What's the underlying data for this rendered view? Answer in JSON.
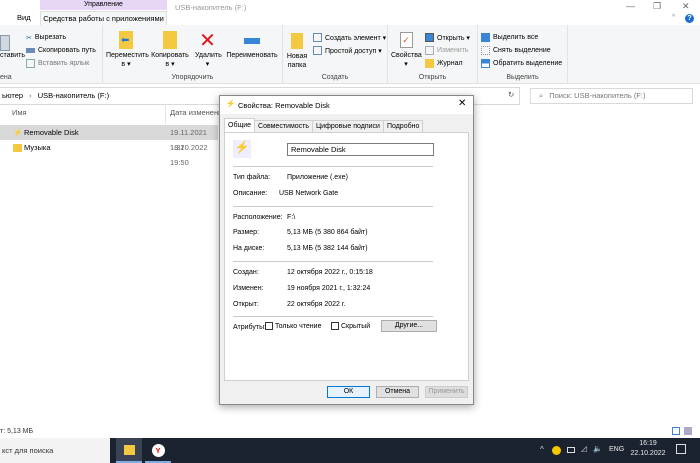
{
  "window": {
    "title": "USB-накопитель (F:)",
    "context_group": "Управление",
    "minimize": "—",
    "maximize": "❐",
    "close": "✕",
    "help": "?"
  },
  "tabs": {
    "view": "Вид",
    "app_tools": "Средства работы с приложениями"
  },
  "ribbon": {
    "clipboard": {
      "paste": "ставить",
      "cut": "Вырезать",
      "copy_path": "Скопировать путь",
      "paste_shortcut": "Вставить ярлык",
      "label": "ена"
    },
    "organize": {
      "move": "Переместить",
      "move2": "в ▾",
      "copy": "Копировать",
      "copy2": "в ▾",
      "delete": "Удалить",
      "delete2": "▾",
      "rename": "Переименовать",
      "label": "Упорядочить"
    },
    "create": {
      "new_folder": "Новая",
      "new_folder2": "папка",
      "new_item": "Создать элемент ▾",
      "easy_access": "Простой доступ ▾",
      "label": "Создать"
    },
    "open": {
      "properties": "Свойства",
      "properties2": "▾",
      "open": "Открыть ▾",
      "edit": "Изменить",
      "history": "Журнал",
      "label": "Открыть"
    },
    "select": {
      "select_all": "Выделить все",
      "select_none": "Снять выделение",
      "invert": "Обратить выделение",
      "label": "Выделить"
    }
  },
  "address": {
    "path_prefix": "ьютер",
    "sep": "›",
    "path": "USB-накопитель (F:)",
    "search_placeholder": "Поиск: USB-накопитель (F:)"
  },
  "columns": {
    "name": "Имя",
    "date": "Дата изменения"
  },
  "files": [
    {
      "name": "Removable Disk",
      "date": "19.11.2021 1:32"
    },
    {
      "name": "Музыка",
      "date": "18.10.2022 19:50"
    }
  ],
  "status": {
    "text": "т: 5,13 МБ"
  },
  "dialog": {
    "title": "Свойства: Removable Disk",
    "tabs": [
      "Общие",
      "Совместимость",
      "Цифровые подписи",
      "Подробно"
    ],
    "name": "Removable Disk",
    "rows": [
      {
        "label": "Тип файла:",
        "value": "Приложение (.exe)"
      },
      {
        "label": "Описание:",
        "value": "USB Network Gate"
      },
      {
        "label": "Расположение:",
        "value": "F:\\"
      },
      {
        "label": "Размер:",
        "value": "5,13 МБ (5 380 864 байт)"
      },
      {
        "label": "На диске:",
        "value": "5,13 МБ (5 382 144 байт)"
      },
      {
        "label": "Создан:",
        "value": "12 октября 2022 г., 0:15:18"
      },
      {
        "label": "Изменен:",
        "value": "19 ноября 2021 г., 1:32:24"
      },
      {
        "label": "Открыт:",
        "value": "22 октября 2022 г."
      }
    ],
    "attributes": "Атрибуты:",
    "readonly": "Только чтение",
    "hidden": "Скрытый",
    "other": "Другие...",
    "ok": "ОК",
    "cancel": "Отмена",
    "apply": "Применить"
  },
  "taskbar": {
    "search": "кст для поиска",
    "lang": "ENG",
    "time": "16:19",
    "date": "22.10.2022"
  }
}
